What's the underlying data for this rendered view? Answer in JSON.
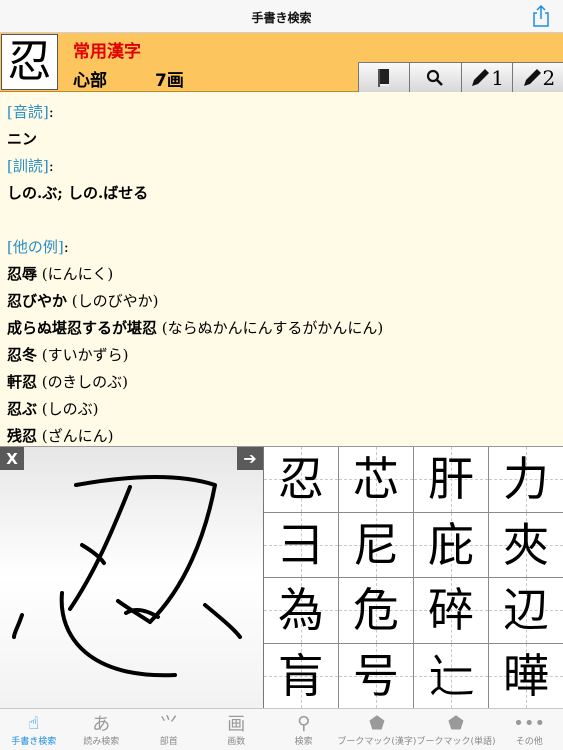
{
  "nav": {
    "title": "手書き検索"
  },
  "kanji": {
    "character": "忍",
    "grade": "常用漢字",
    "radical": "心部",
    "strokes": "7画"
  },
  "toolbar": {
    "buttons": [
      {
        "name": "book-icon",
        "label": ""
      },
      {
        "name": "search-icon",
        "label": ""
      },
      {
        "name": "pencil-1",
        "label": "1"
      },
      {
        "name": "pencil-2",
        "label": "2"
      }
    ]
  },
  "detail": {
    "on_heading": "[音読]",
    "on_value": "ニン",
    "kun_heading": "[訓読]",
    "kun_value": "しの.ぶ; しの.ばせる",
    "examples_heading": "[他の例]",
    "colon": ":",
    "examples": [
      {
        "word": "忍辱",
        "reading": " (にんにく)"
      },
      {
        "word": "忍びやか",
        "reading": " (しのびやか)"
      },
      {
        "word": "成らぬ堪忍するが堪忍",
        "reading": " (ならぬかんにんするがかんにん)"
      },
      {
        "word": "忍冬",
        "reading": " (すいかずら)"
      },
      {
        "word": "軒忍",
        "reading": " (のきしのぶ)"
      },
      {
        "word": "忍ぶ",
        "reading": " (しのぶ)"
      },
      {
        "word": "残忍",
        "reading": " (ざんにん)"
      }
    ]
  },
  "handwriting": {
    "clear_label": "X",
    "next_label": "➔"
  },
  "candidates": [
    "忍",
    "芯",
    "肝",
    "力",
    "彐",
    "尼",
    "庇",
    "夾",
    "為",
    "危",
    "碎",
    "辺",
    "肓",
    "号",
    "辷",
    "曄"
  ],
  "tabs": [
    {
      "label": "手書き検索",
      "icon": "hand-icon",
      "glyph": "☝",
      "active": true
    },
    {
      "label": "読み検索",
      "icon": "hiragana-a-icon",
      "glyph": "あ",
      "active": false
    },
    {
      "label": "部首",
      "icon": "radical-icon",
      "glyph": "⺍",
      "active": false
    },
    {
      "label": "画数",
      "icon": "stroke-count-icon",
      "glyph": "画",
      "active": false
    },
    {
      "label": "検索",
      "icon": "search-icon",
      "glyph": "⚲",
      "active": false
    },
    {
      "label": "ブークマック(漢字)",
      "icon": "tag-icon",
      "glyph": "⬟",
      "active": false
    },
    {
      "label": "ブークマック(単語)",
      "icon": "tag-icon",
      "glyph": "⬟",
      "active": false
    },
    {
      "label": "その他",
      "icon": "more-icon",
      "glyph": "•••",
      "active": false
    }
  ],
  "colors": {
    "accent": "#1a8fe3",
    "header_bg": "#fdc55e",
    "heading_blue": "#2a8ec8",
    "grade_red": "#e00000"
  }
}
